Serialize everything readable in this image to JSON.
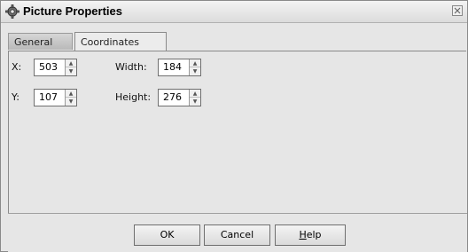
{
  "window": {
    "title": "Picture Properties"
  },
  "tabs": [
    {
      "label": "General",
      "selected": false
    },
    {
      "label": "Coordinates",
      "selected": true
    }
  ],
  "fields": {
    "x": {
      "label": "X:",
      "value": "503"
    },
    "y": {
      "label": "Y:",
      "value": "107"
    },
    "width": {
      "label": "Width:",
      "value": "184"
    },
    "height": {
      "label": "Height:",
      "value": "276"
    }
  },
  "buttons": {
    "ok": "OK",
    "cancel": "Cancel",
    "help_mnemonic": "H",
    "help_rest": "elp"
  },
  "icons": {
    "title": "gear-icon",
    "close": "close-icon"
  }
}
